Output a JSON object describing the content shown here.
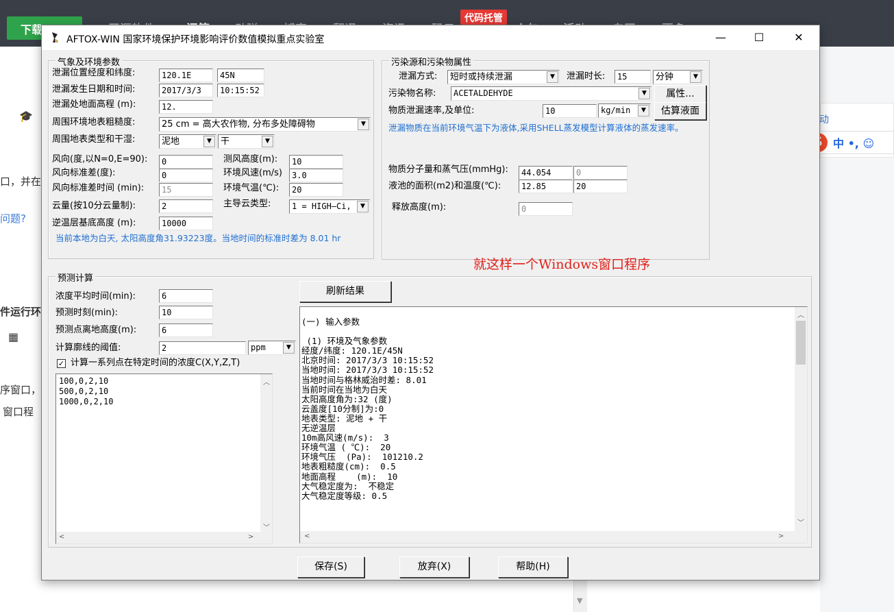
{
  "background": {
    "download_label": "下载",
    "nav_items": [
      "开源软件",
      "问答",
      "动弹",
      "博客",
      "翻译",
      "资讯",
      "码云",
      "众包",
      "活动",
      "专区",
      "更多"
    ],
    "hosting_badge": "代码托管",
    "left_fragments": [
      "口，并在",
      "问题?",
      "件运行环",
      "序窗口，",
      "窗口程"
    ],
    "right_link": "动",
    "ime_s": "S",
    "ime_text": "中 •, ☺"
  },
  "window": {
    "title": "AFTOX-WIN 国家环境保护环境影响评价数值模拟重点实验室",
    "minimize": "—",
    "maximize": "☐",
    "close": "✕"
  },
  "met": {
    "legend": "气象及环境参数",
    "lon_lat_label": "泄漏位置经度和纬度:",
    "lon": "120.1E",
    "lat": "45N",
    "datetime_label": "泄漏发生日期和时间:",
    "date": "2017/3/3",
    "time": "10:15:52",
    "elev_label": "泄漏处地面高程 (m):",
    "elev": "12.",
    "rough_label": "周围环境地表粗糙度:",
    "rough": "25  cm = 高大农作物, 分布多处障碍物",
    "surface_label": "周围地表类型和干湿:",
    "surface_type": "泥地",
    "surface_wet": "干",
    "wind_dir_label": "风向(度,以N=0,E=90):",
    "wind_dir": "0",
    "wind_std_label": "风向标准差(度):",
    "wind_std": "0",
    "wind_std_time_label": "风向标准差时间 (min):",
    "wind_std_time": "15",
    "wind_height_label": "测风高度(m):",
    "wind_height": "10",
    "wind_speed_label": "环境风速(m/s)",
    "wind_speed": "3.0",
    "air_temp_label": "环境气温(℃):",
    "air_temp": "20",
    "cloud_label": "云量(按10分云量制):",
    "cloud": "2",
    "cloud_type_label": "主导云类型:",
    "cloud_type": "1 = HIGH—Ci,",
    "inversion_label": "逆温层基底高度 (m):",
    "inversion": "10000",
    "note": "当前本地为白天, 太阳高度角31.93223度。当地时间的标准时差为 8.01 hr"
  },
  "source": {
    "legend": "污染源和污染物属性",
    "mode_label": "泄漏方式:",
    "mode": "短时或持续泄漏",
    "duration_label": "泄漏时长:",
    "duration": "15",
    "duration_unit": "分钟",
    "pollutant_label": "污染物名称:",
    "pollutant": "ACETALDEHYDE",
    "attr_button": "属性...",
    "rate_label": "物质泄漏速率,及单位:",
    "rate": "10",
    "rate_unit": "kg/min",
    "estimate_button": "估算液面",
    "note": "泄漏物质在当前环境气温下为液体,采用SHELL蒸发模型计算液体的蒸发速率。",
    "mw_label": "物质分子量和蒸气压(mmHg):",
    "mw": "44.054",
    "vp": "0",
    "pool_label": "液池的面积(m2)和温度(℃):",
    "pool_area": "12.85",
    "pool_temp": "20",
    "release_height_label": "释放高度(m):",
    "release_height": "0"
  },
  "annotation": "就这样一个Windows窗口程序",
  "predict": {
    "legend": "预测计算",
    "avg_time_label": "浓度平均时间(min):",
    "avg_time": "6",
    "pred_time_label": "预测时刻(min):",
    "pred_time": "10",
    "point_height_label": "预测点离地高度(m):",
    "point_height": "6",
    "threshold_label": "计算廓线的阈值:",
    "threshold": "2",
    "threshold_unit": "ppm",
    "series_label": "计算一系列点在特定时间的浓度C(X,Y,Z,T)",
    "series_text": "100,0,2,10\n500,0,2,10\n1000,0,2,10",
    "refresh_button": "刷新结果",
    "results_text": "(一) 输入参数\n\n (1) 环境及气象参数\n经度/纬度: 120.1E/45N\n北京时间: 2017/3/3 10:15:52\n当地时间: 2017/3/3 10:15:52\n当地时间与格林威治时差: 8.01\n当前时间在当地为白天\n太阳高度角为:32 (度)\n云盖度[10分制]为:0\n地表类型: 泥地 + 干\n无逆温层\n10m高风速(m/s):  3\n环境气温 ( ℃):  20\n环境气压  (Pa):  101210.2\n地表粗糙度(cm):  0.5\n地面高程    (m):  10\n大气稳定度为:  不稳定\n大气稳定度等级: 0.5"
  },
  "footer": {
    "save": "保存(S)",
    "discard": "放弃(X)",
    "help": "帮助(H)"
  }
}
